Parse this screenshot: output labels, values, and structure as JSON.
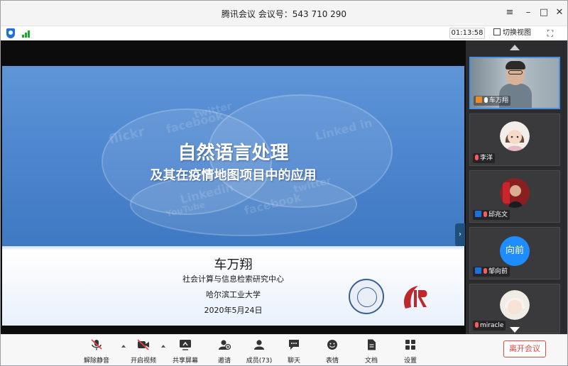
{
  "window": {
    "title": "腾讯会议 会议号：543 710 290",
    "controls": {
      "settings": "≡",
      "minimize": "–",
      "maximize": "□",
      "close": "✕"
    }
  },
  "status": {
    "timer": "01:13:58",
    "switch_view": "切换视图",
    "fullscreen": "⛶"
  },
  "slide": {
    "title": "自然语言处理",
    "subtitle": "及其在疫情地图项目中的应用",
    "author": "车万翔",
    "lab": "社会计算与信息检索研究中心",
    "university": "哈尔滨工业大学",
    "date": "2020年5月24日",
    "watermarks": [
      "flickr",
      "facebook",
      "twitter",
      "Linked in",
      "YouTube",
      "facebook",
      "Linkedin",
      "twitter"
    ]
  },
  "participants": [
    {
      "name": "车万翔",
      "type": "video"
    },
    {
      "name": "李洋",
      "type": "avatar"
    },
    {
      "name": "邱兆文",
      "type": "photo"
    },
    {
      "name": "邹向前",
      "type": "text",
      "avatar_text": "向前"
    },
    {
      "name": "miracle",
      "type": "avatar"
    }
  ],
  "toolbar": {
    "unmute": "解除静音",
    "video": "开启视频",
    "share": "共享屏幕",
    "invite": "邀请",
    "members": "成员(73)",
    "chat": "聊天",
    "emoji": "表情",
    "docs": "文档",
    "settings": "设置",
    "leave": "离开会议"
  },
  "colors": {
    "accent_blue": "#1f8cff",
    "leave_red": "#e64545",
    "signal_green": "#1aaa2a"
  }
}
